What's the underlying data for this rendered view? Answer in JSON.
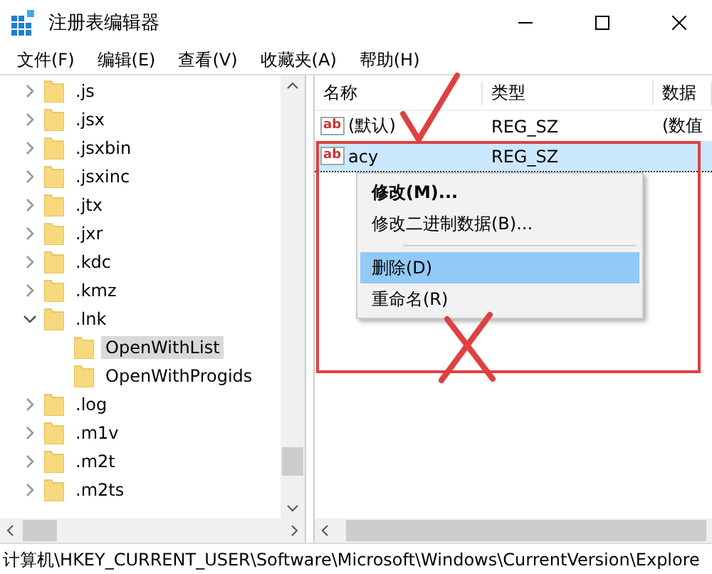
{
  "window": {
    "title": "注册表编辑器"
  },
  "menu": [
    "文件(F)",
    "编辑(E)",
    "查看(V)",
    "收藏夹(A)",
    "帮助(H)"
  ],
  "tree": {
    "items": [
      {
        "label": ".js",
        "expanded": false,
        "selected": false
      },
      {
        "label": ".jsx",
        "expanded": false,
        "selected": false
      },
      {
        "label": ".jsxbin",
        "expanded": false,
        "selected": false
      },
      {
        "label": ".jsxinc",
        "expanded": false,
        "selected": false
      },
      {
        "label": ".jtx",
        "expanded": false,
        "selected": false
      },
      {
        "label": ".jxr",
        "expanded": false,
        "selected": false
      },
      {
        "label": ".kdc",
        "expanded": false,
        "selected": false
      },
      {
        "label": ".kmz",
        "expanded": false,
        "selected": false
      },
      {
        "label": ".lnk",
        "expanded": true,
        "selected": false,
        "children": [
          {
            "label": "OpenWithList",
            "selected": true
          },
          {
            "label": "OpenWithProgids",
            "selected": false
          }
        ]
      },
      {
        "label": ".log",
        "expanded": false,
        "selected": false
      },
      {
        "label": ".m1v",
        "expanded": false,
        "selected": false
      },
      {
        "label": ".m2t",
        "expanded": false,
        "selected": false
      },
      {
        "label": ".m2ts",
        "expanded": false,
        "selected": false
      }
    ]
  },
  "values": {
    "columns": [
      "名称",
      "类型",
      "数据"
    ],
    "rows": [
      {
        "icon": "ab",
        "name": "(默认)",
        "type": "REG_SZ",
        "data": "(数值",
        "selected": false
      },
      {
        "icon": "ab",
        "name": "acy",
        "type": "REG_SZ",
        "selected": true
      }
    ]
  },
  "context_menu": {
    "items": [
      {
        "kind": "item",
        "label": "修改(M)...",
        "default": true,
        "selected": false
      },
      {
        "kind": "item",
        "label": "修改二进制数据(B)...",
        "default": false,
        "selected": false
      },
      {
        "kind": "separator"
      },
      {
        "kind": "item",
        "label": "删除(D)",
        "default": false,
        "selected": true
      },
      {
        "kind": "item",
        "label": "重命名(R)",
        "default": false,
        "selected": false
      }
    ]
  },
  "status_bar": "计算机\\HKEY_CURRENT_USER\\Software\\Microsoft\\Windows\\CurrentVersion\\Explore"
}
